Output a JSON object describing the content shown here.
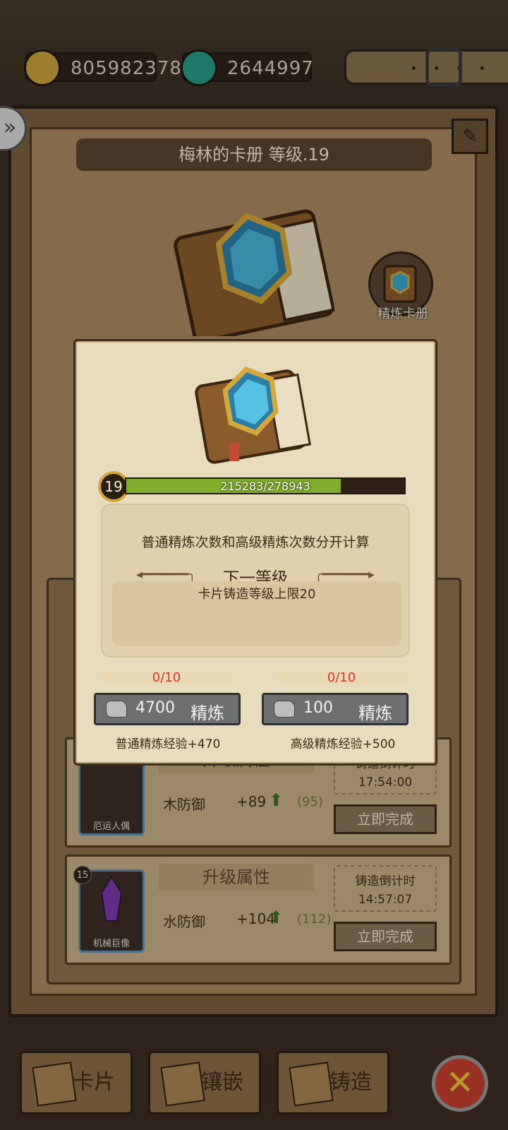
{
  "currency": {
    "gold": "805982378",
    "gems": "2644997"
  },
  "header": {
    "title": "梅林的卡册 等级.19",
    "refine_book_label": "精炼卡册"
  },
  "forge_rows": [
    {
      "card_name": "厄运人偶",
      "head": "升级属性",
      "attr": "木防御",
      "plus": "+89",
      "max": "(95)",
      "timer_label": "铸造倒计时",
      "timer": "17:54:00",
      "finish": "立即完成"
    },
    {
      "card_level": "15",
      "card_name": "机械巨像",
      "head": "升级属性",
      "attr": "水防御",
      "plus": "+104",
      "max": "(112)",
      "timer_label": "铸造倒计时",
      "timer": "14:57:07",
      "finish": "立即完成"
    }
  ],
  "tabs": [
    {
      "label": "卡片"
    },
    {
      "label": "镶嵌"
    },
    {
      "label": "铸造"
    }
  ],
  "dialog": {
    "level": "19",
    "xp_text": "215283/278943",
    "xp_fraction": 0.7718,
    "note": "普通精炼次数和高级精炼次数分开计算",
    "next_level_title": "下一等级",
    "unlock": "卡片铸造等级上限20",
    "normal": {
      "count": "0/10",
      "cost": "4700",
      "label": "精炼",
      "exp": "普通精炼经验+470"
    },
    "advanced": {
      "count": "0/10",
      "cost": "100",
      "label": "精炼",
      "exp": "高级精炼经验+500"
    }
  },
  "icons": {
    "gold": "gold-ore-icon",
    "gem": "gem-icon",
    "back": "chevron-right-icon",
    "edit": "pencil-icon",
    "close": "close-icon"
  },
  "colors": {
    "xp_fill": "#7fae2c",
    "count_red": "#d9342a",
    "close_red": "#c4412c"
  }
}
